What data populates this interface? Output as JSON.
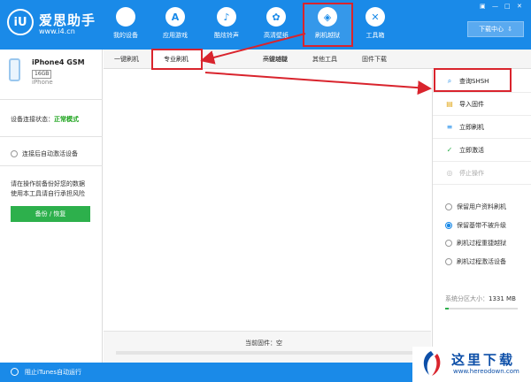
{
  "app": {
    "title": "爱思助手",
    "url": "www.i4.cn",
    "logo_glyph": "iU",
    "accent_color": "#1a8ae8",
    "highlight_color": "#d9242d"
  },
  "window_controls": {
    "skin": "▣",
    "minimize": "—",
    "maximize": "□",
    "close": "✕"
  },
  "nav": {
    "items": [
      {
        "label": "我的设备",
        "icon": "apple-icon",
        "glyph": ""
      },
      {
        "label": "应用游戏",
        "icon": "app-store-icon",
        "glyph": "A"
      },
      {
        "label": "酷炫铃声",
        "icon": "bell-icon",
        "glyph": "♪"
      },
      {
        "label": "高清壁纸",
        "icon": "flower-icon",
        "glyph": "✿"
      },
      {
        "label": "刷机越狱",
        "icon": "dropbox-icon",
        "glyph": "◈"
      },
      {
        "label": "工具箱",
        "icon": "tools-icon",
        "glyph": "✕"
      }
    ],
    "active": "刷机越狱",
    "download_label": "下载中心"
  },
  "device": {
    "name": "iPhone4 GSM",
    "capacity": "16GB",
    "type": "iPhone",
    "status_label": "设备连接状态：",
    "status_value": "正常模式",
    "auto_activate_label": "连接后自动激活设备",
    "warning_line1": "请在操作前备份好您的数据",
    "warning_line2": "使用本工具请自行承担风险",
    "backup_label": "备份 / 恢复"
  },
  "tabs": [
    "一键刷机",
    "专业刷机",
    "一键越狱",
    "高级功能",
    "其他工具",
    "固件下载"
  ],
  "active_tab": "专业刷机",
  "main": {
    "firmware_label": "当前固件：空"
  },
  "actions": [
    {
      "label": "查询SHSH",
      "icon": "search-icon",
      "glyph": "⌕",
      "enabled": true,
      "color": "#1a8ae8"
    },
    {
      "label": "导入固件",
      "icon": "folder-icon",
      "glyph": "▤",
      "enabled": true,
      "color": "#e2a81c"
    },
    {
      "label": "立即刷机",
      "icon": "flash-icon",
      "glyph": "≡",
      "enabled": true,
      "color": "#1a8ae8"
    },
    {
      "label": "立即激活",
      "icon": "check-circle-icon",
      "glyph": "✓",
      "enabled": true,
      "color": "#2db04c"
    },
    {
      "label": "停止操作",
      "icon": "stop-icon",
      "glyph": "◎",
      "enabled": false,
      "color": "#bbbbbb"
    }
  ],
  "options": [
    {
      "label": "保留用户资料刷机",
      "checked": false
    },
    {
      "label": "保留基带不被升级",
      "checked": true
    },
    {
      "label": "刷机过程重捷越狱",
      "checked": false
    },
    {
      "label": "刷机过程激活设备",
      "checked": false
    }
  ],
  "system": {
    "label": "系统分区大小：",
    "value": "1331 MB",
    "fill_fraction": 0.05
  },
  "statusbar": {
    "label": "阻止iTunes自动运行"
  },
  "watermark": {
    "text": "这里下载",
    "url": "www.hereodown.com"
  }
}
